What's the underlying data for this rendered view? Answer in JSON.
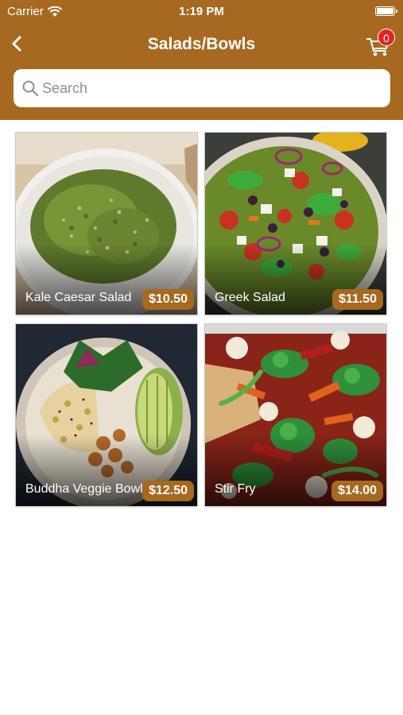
{
  "status_bar": {
    "carrier": "Carrier",
    "time": "1:19 PM"
  },
  "nav": {
    "title": "Salads/Bowls",
    "cart_count": "0"
  },
  "search": {
    "placeholder": "Search",
    "value": ""
  },
  "colors": {
    "header": "#a7691f",
    "price_badge": "#a7691f",
    "cart_badge": "#e4221f"
  },
  "items": [
    {
      "name": "Kale Caesar Salad",
      "price": "$10.50"
    },
    {
      "name": "Greek Salad",
      "price": "$11.50"
    },
    {
      "name": "Buddha Veggie Bowl",
      "price": "$12.50"
    },
    {
      "name": "Stir Fry",
      "price": "$14.00"
    }
  ]
}
